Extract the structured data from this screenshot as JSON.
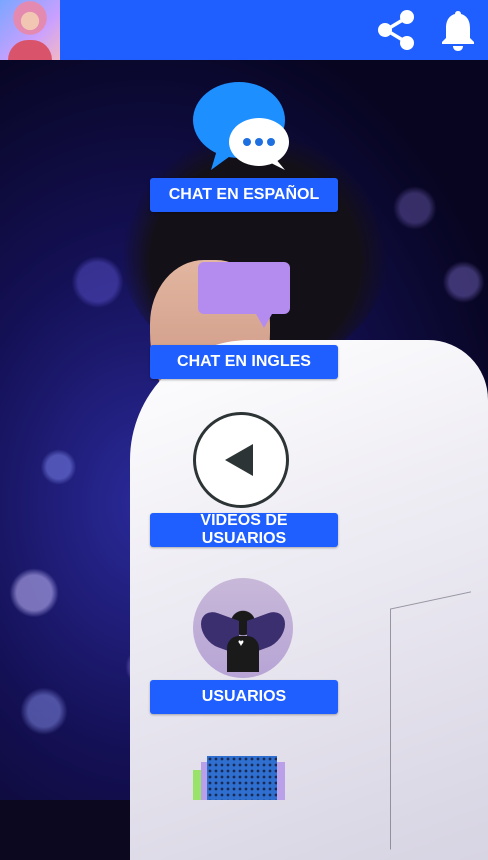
{
  "header": {
    "avatar_icon": "profile-photo",
    "share_icon": "share-icon",
    "notifications_icon": "bell-icon",
    "bar_color": "#1f5fff"
  },
  "menu": {
    "items": [
      {
        "label": "CHAT EN ESPAÑOL",
        "icon": "chat-bubble-icon"
      },
      {
        "label": "CHAT EN INGLES",
        "icon": "speech-bubble-icon"
      },
      {
        "label": "VIDEOS DE USUARIOS",
        "icon": "play-icon"
      },
      {
        "label": "USUARIOS",
        "icon": "user-avatar-icon"
      }
    ],
    "button_color": "#1f5fff"
  }
}
